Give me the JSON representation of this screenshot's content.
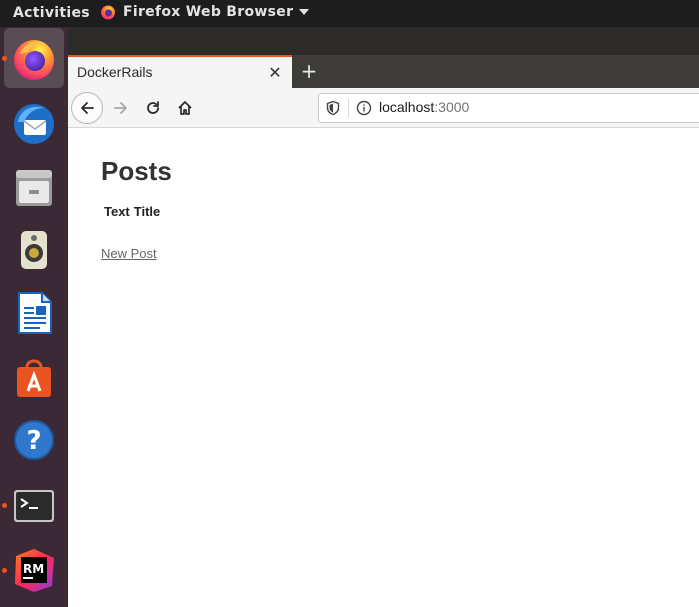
{
  "topbar": {
    "activities_label": "Activities",
    "app_menu_label": "Firefox Web Browser"
  },
  "dock": {
    "items": [
      {
        "name": "firefox-icon",
        "running": true,
        "active": true
      },
      {
        "name": "thunderbird-icon",
        "running": false
      },
      {
        "name": "files-icon",
        "running": false
      },
      {
        "name": "rhythmbox-icon",
        "running": false
      },
      {
        "name": "libreoffice-writer-icon",
        "running": false
      },
      {
        "name": "software-center-icon",
        "running": false
      },
      {
        "name": "help-icon",
        "running": false
      },
      {
        "name": "terminal-icon",
        "running": true
      },
      {
        "name": "rubymine-icon",
        "running": true
      }
    ],
    "rubymine_label": "RM"
  },
  "browser": {
    "tab_title": "DockerRails",
    "tab_close_glyph": "✕",
    "new_tab_glyph": "+",
    "url_host": "localhost",
    "url_port": ":3000"
  },
  "page": {
    "title": "Posts",
    "table_headers": [
      "Text",
      "Title"
    ],
    "new_post_link": "New Post"
  },
  "colors": {
    "accent": "#e95420",
    "dock_bg": "#3b2a35",
    "topbar_bg": "#1d1d1d"
  }
}
